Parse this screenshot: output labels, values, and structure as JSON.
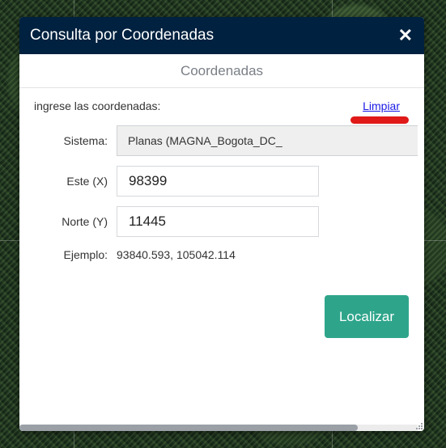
{
  "window": {
    "title": "Consulta por Coordenadas",
    "close_icon": "close-icon"
  },
  "section": {
    "title": "Coordenadas"
  },
  "instructions": {
    "text": "ingrese las coordenadas:",
    "clear_link": "Limpiar"
  },
  "form": {
    "system_label": "Sistema:",
    "system_value": "Planas (MAGNA_Bogota_DC_",
    "east_label": "Este (X)",
    "east_value": "98399",
    "north_label": "Norte (Y)",
    "north_value": "11445",
    "example_label": "Ejemplo:",
    "example_value": "93840.593, 105042.114"
  },
  "actions": {
    "locate_label": "Localizar"
  },
  "colors": {
    "titlebar": "#00213f",
    "button": "#2ea58b",
    "link": "#1a1ae6",
    "annotation": "#e01919"
  }
}
